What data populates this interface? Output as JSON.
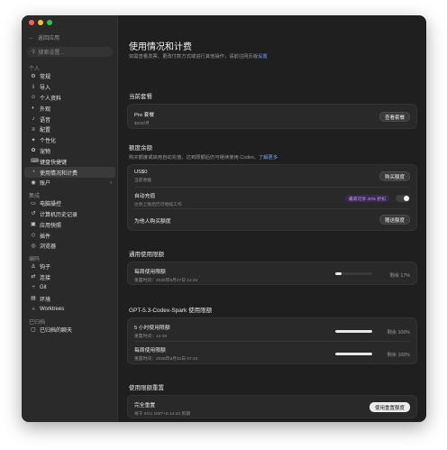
{
  "colors": {
    "close": "#ff5f57",
    "minimize": "#febc2e",
    "zoom": "#28c840",
    "link": "#6ea6ff",
    "badge_text": "#c59bff"
  },
  "sidebar": {
    "back_label": "返回应用",
    "search_placeholder": "搜索设置...",
    "sections": [
      {
        "title": "个人",
        "items": [
          {
            "label": "常规",
            "icon": "gear-icon"
          },
          {
            "label": "导入",
            "icon": "import-icon"
          },
          {
            "label": "个人资料",
            "icon": "profile-icon"
          },
          {
            "label": "外观",
            "icon": "appearance-icon"
          },
          {
            "label": "语音",
            "icon": "voice-icon"
          },
          {
            "label": "配置",
            "icon": "config-icon"
          },
          {
            "label": "个性化",
            "icon": "personalize-icon"
          },
          {
            "label": "宠物",
            "icon": "pet-icon"
          },
          {
            "label": "键盘快捷键",
            "icon": "keyboard-icon"
          },
          {
            "label": "使用情况和计费",
            "icon": "usage-icon",
            "active": true
          },
          {
            "label": "账户",
            "icon": "account-icon",
            "chevron": true
          }
        ]
      },
      {
        "title": "集成",
        "items": [
          {
            "label": "电脑操控",
            "icon": "computer-icon"
          },
          {
            "label": "计算机历史记录",
            "icon": "history-icon"
          },
          {
            "label": "应用快照",
            "icon": "snapshot-icon"
          },
          {
            "label": "插件",
            "icon": "plugin-icon"
          },
          {
            "label": "浏览器",
            "icon": "browser-icon"
          }
        ]
      },
      {
        "title": "编码",
        "items": [
          {
            "label": "钩子",
            "icon": "hook-icon"
          },
          {
            "label": "连接",
            "icon": "connect-icon"
          },
          {
            "label": "Git",
            "icon": "git-icon"
          },
          {
            "label": "环境",
            "icon": "environment-icon"
          },
          {
            "label": "Worktrees",
            "icon": "worktrees-icon"
          }
        ]
      },
      {
        "title": "已归档",
        "items": [
          {
            "label": "已归档的聊天",
            "icon": "archive-icon"
          }
        ]
      }
    ]
  },
  "main": {
    "title": "使用情况和计费",
    "subtitle_prefix": "如需查看发票、更改付款方式或进行其他操作，请前往网页版",
    "subtitle_link": "设置",
    "current_plan": {
      "heading": "当前套餐",
      "plan_name": "Pro 套餐",
      "plan_price": "$200/月",
      "view_button": "查看套餐"
    },
    "credits": {
      "heading": "额度余额",
      "desc": "购买额度或启用自动充值，达到限额后仍可继续使用 Codex。",
      "learn_more": "了解更多",
      "balance": "US$0",
      "balance_label": "当前余额",
      "buy_button": "购买额度",
      "auto_title": "自动充值",
      "auto_sub": "达到上限后仍可继续工作",
      "save_badge": "最高可享 40% 折扣",
      "gift_title": "为他人购买额度",
      "gift_button": "赠送额度"
    },
    "general_limits": {
      "heading": "通用使用限额",
      "title": "每周使用限额",
      "reset": "重置时间：2026年8月27日 11:43",
      "remaining": "剩余 17%",
      "fill": 0.17
    },
    "spark_limits": {
      "heading": "GPT-5.3-Codex-Spark 使用限额",
      "rows": [
        {
          "title": "5 小时使用限额",
          "reset": "重置时间：12:49",
          "remaining": "剩余 100%",
          "fill": 1.0
        },
        {
          "title": "每周使用限额",
          "reset": "重置时间：2026年8月31日 07:40",
          "remaining": "剩余 100%",
          "fill": 1.0
        }
      ]
    },
    "reset": {
      "heading": "使用限额重置",
      "title": "完全重置",
      "sub": "将于 9/21 GMT+8 12:34 到期",
      "button": "使用重置额度"
    }
  }
}
